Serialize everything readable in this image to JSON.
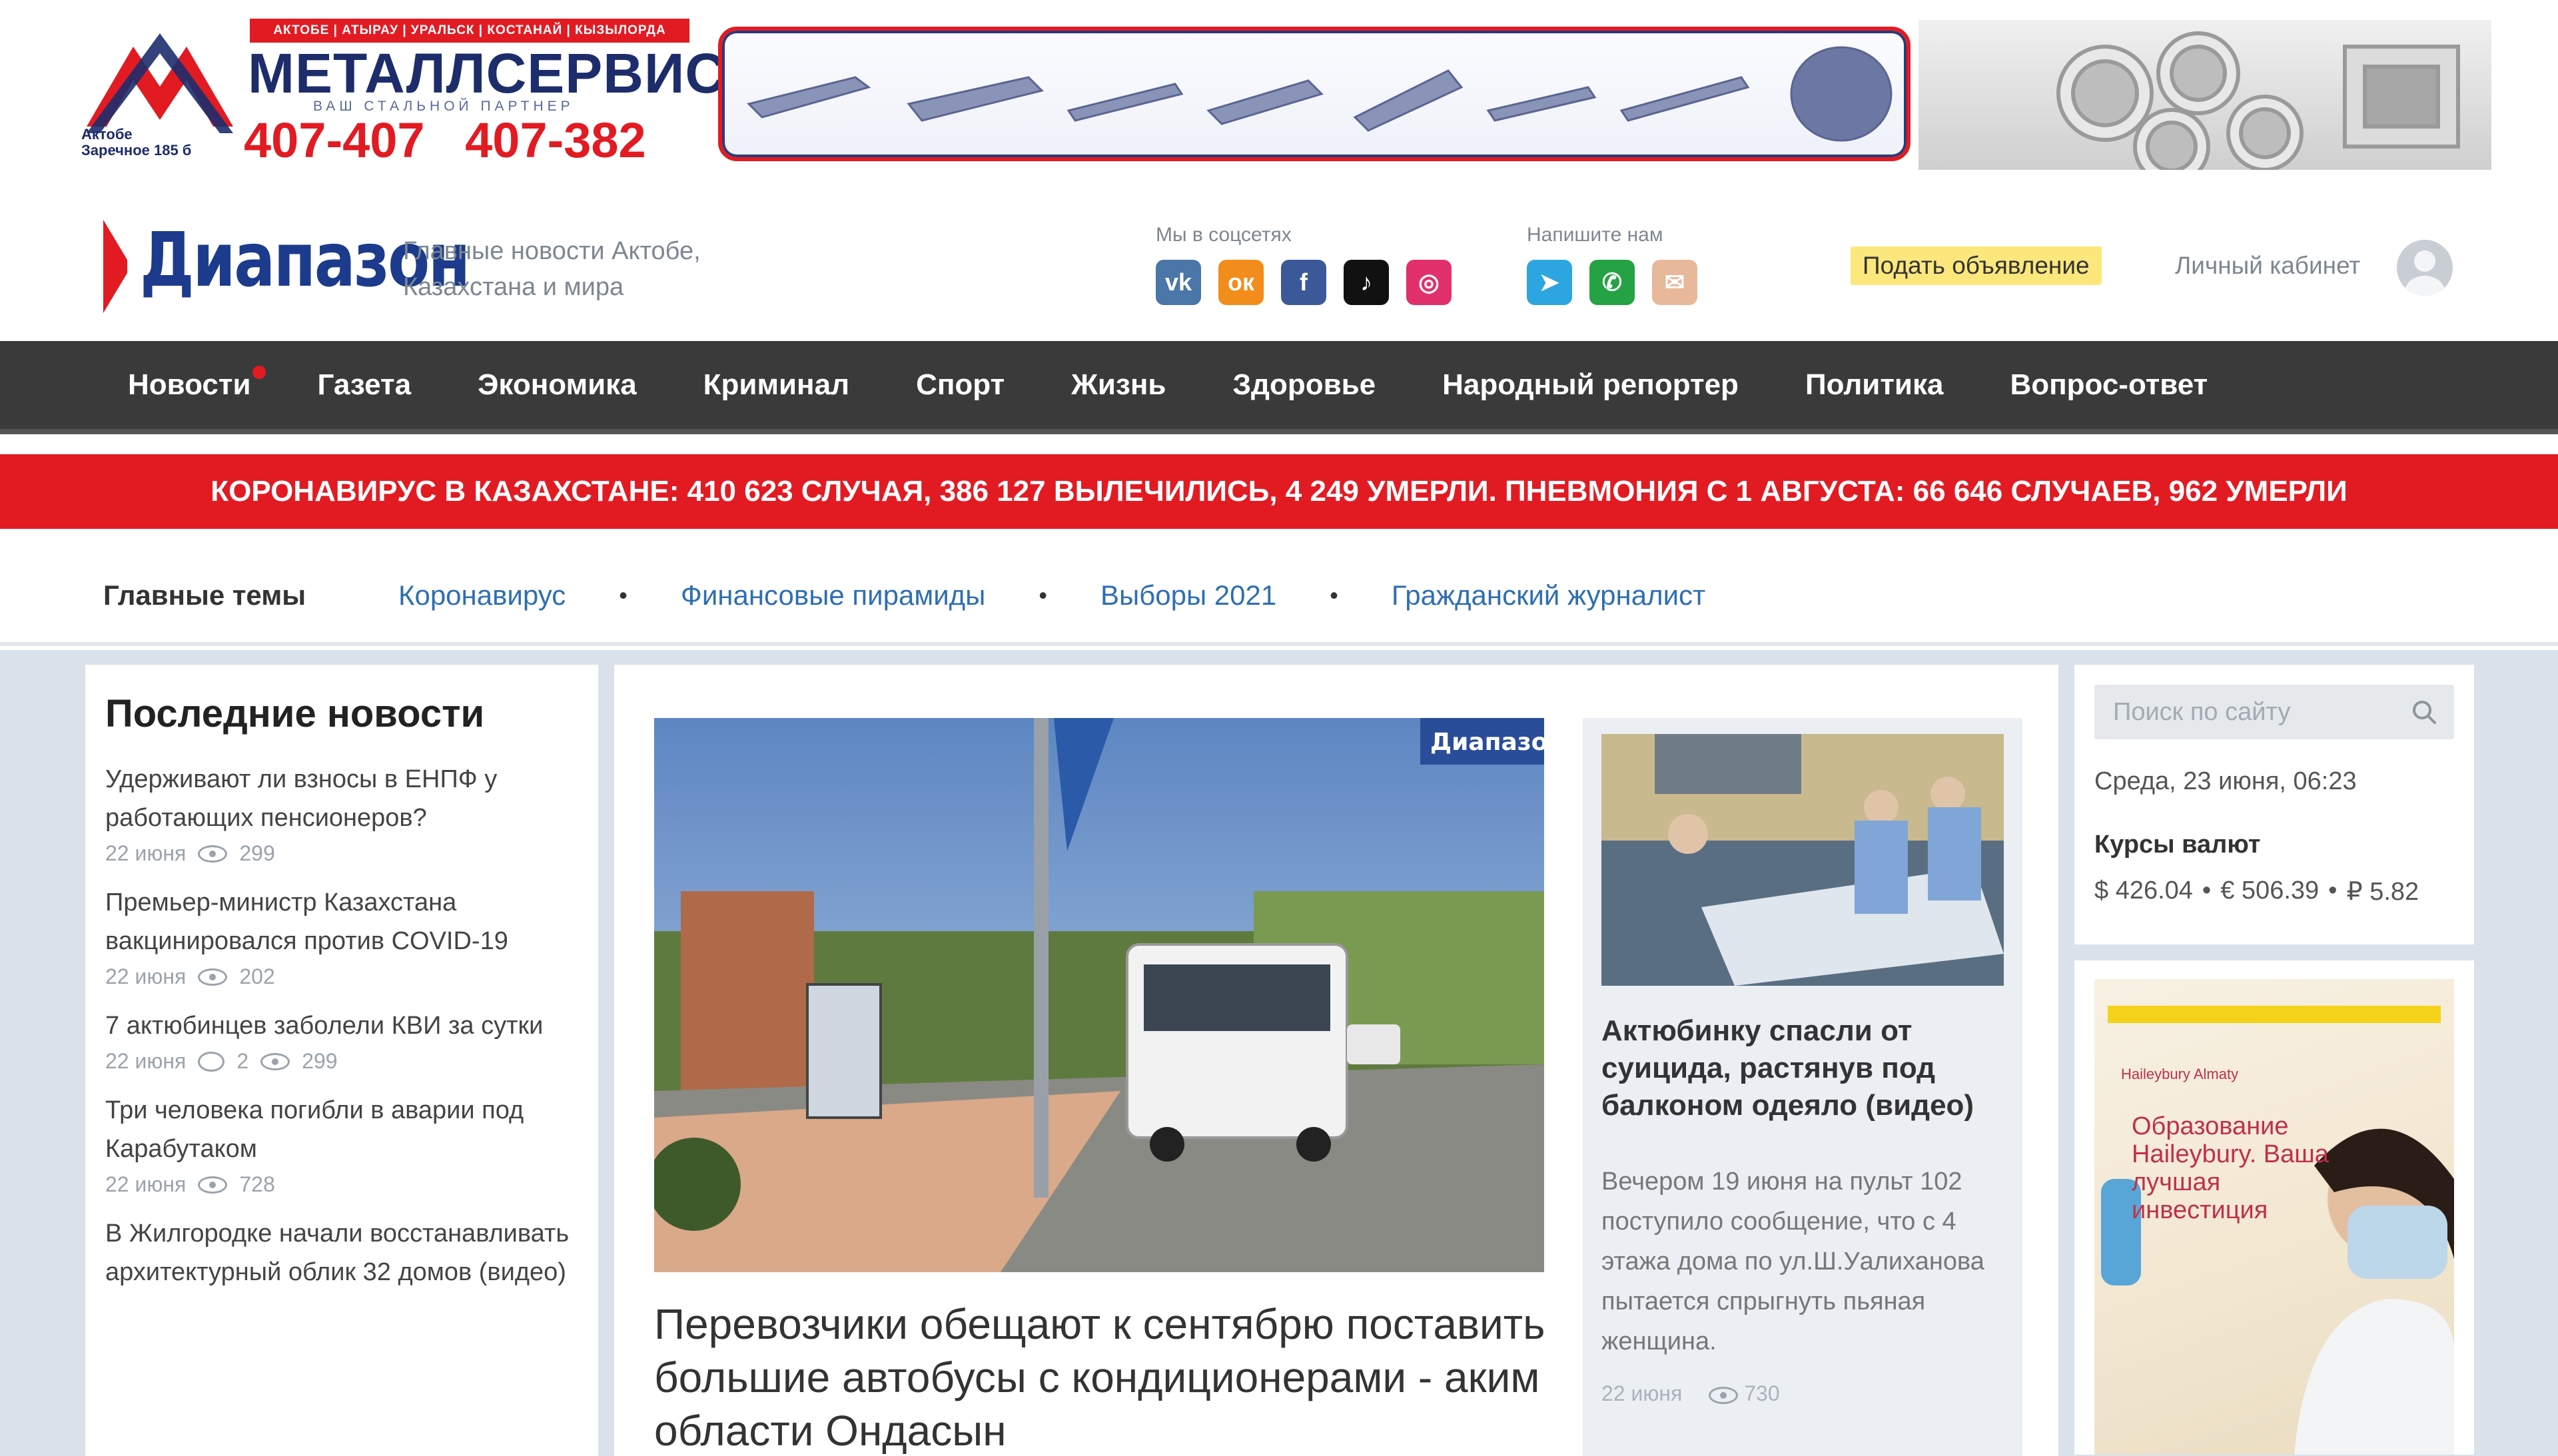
{
  "banner": {
    "city": "Актобе\nЗаречное 185 б",
    "strip": "АКТОБЕ | АТЫРАУ | УРАЛЬСК | КОСТАНАЙ | КЫЗЫЛОРДА",
    "brand": "МЕТАЛЛСЕРВИС",
    "tagline": "ВАШ СТАЛЬНОЙ ПАРТНЕР",
    "phones": "407-407 407-382"
  },
  "header": {
    "logo": "Диапазон",
    "tagline": "Главные новости Актобе, Казахстана и мира",
    "social_label": "Мы в соцсетях",
    "write_label": "Напишите нам",
    "post_ad": "Подать объявление",
    "cabinet": "Личный кабинет"
  },
  "social": [
    {
      "name": "vk-icon",
      "glyph": "vk",
      "color": "#4a76a8"
    },
    {
      "name": "odnoklassniki-icon",
      "glyph": "ок",
      "color": "#f28c1b"
    },
    {
      "name": "facebook-icon",
      "glyph": "f",
      "color": "#3b5998"
    },
    {
      "name": "tiktok-icon",
      "glyph": "♪",
      "color": "#111111"
    },
    {
      "name": "instagram-icon",
      "glyph": "◎",
      "color": "#e1306c"
    }
  ],
  "contacts": [
    {
      "name": "telegram-icon",
      "glyph": "➤",
      "color": "#2ca5e0"
    },
    {
      "name": "whatsapp-icon",
      "glyph": "✆",
      "color": "#25a244"
    },
    {
      "name": "email-icon",
      "glyph": "✉",
      "color": "#e8b89a"
    }
  ],
  "nav": [
    "Новости",
    "Газета",
    "Экономика",
    "Криминал",
    "Спорт",
    "Жизнь",
    "Здоровье",
    "Народный репортер",
    "Политика",
    "Вопрос-ответ"
  ],
  "ticker": "КОРОНАВИРУС В КАЗАХСТАНЕ: 410 623 СЛУЧАЯ, 386 127 ВЫЛЕЧИЛИСЬ, 4 249 УМЕРЛИ. ПНЕВМОНИЯ С 1 АВГУСТА: 66 646 СЛУЧАЕВ, 962 УМЕРЛИ",
  "topics": {
    "title": "Главные темы",
    "items": [
      "Коронавирус",
      "Финансовые пирамиды",
      "Выборы 2021",
      "Гражданский журналист"
    ]
  },
  "latest": {
    "title": "Последние новости",
    "items": [
      {
        "title": "Удерживают ли взносы в ЕНПФ у работающих пенсионеров?",
        "date": "22 июня",
        "comments": "",
        "views": "299"
      },
      {
        "title": "Премьер-министр Казахстана вакцинировался против COVID-19",
        "date": "22 июня",
        "comments": "",
        "views": "202"
      },
      {
        "title": "7 актюбинцев заболели КВИ за сутки",
        "date": "22 июня",
        "comments": "2",
        "views": "299"
      },
      {
        "title": "Три человека погибли в аварии под Карабутаком",
        "date": "22 июня",
        "comments": "",
        "views": "728"
      },
      {
        "title": "В Жилгородке начали восстанавливать архитектурный облик 32 домов (видео)",
        "date": "",
        "comments": "",
        "views": ""
      }
    ]
  },
  "main_story": {
    "watermark": "Диапазон",
    "headline": "Перевозчики обещают к сентябрю поставить большие автобусы с кондиционерами - аким области Ондасын"
  },
  "side_story": {
    "title": "Актюбинку спасли от суицида, растянув под балконом одеяло (видео)",
    "text": "Вечером 19 июня на пульт 102 поступило сообщение, что с 4 этажа дома по ул.Ш.Уалиханова пытается спрыгнуть пьяная женщина.",
    "date": "22 июня",
    "views": "730"
  },
  "sidebar": {
    "search_placeholder": "Поиск по сайту",
    "date": "Среда, 23 июня, 06:23",
    "rates_title": "Курсы валют",
    "rates": [
      "$ 426.04",
      "€ 506.39",
      "₽ 5.82"
    ],
    "ad_brand": "Haileybury Almaty",
    "ad_text": "Образование Haileybury. Ваша лучшая инвестиция"
  }
}
